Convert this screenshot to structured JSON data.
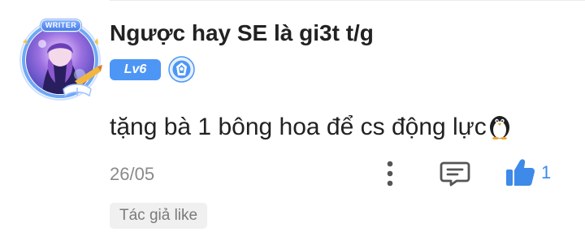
{
  "comment": {
    "username": "Ngược hay SE là gi3t t/g",
    "avatar_badge": "WRITER",
    "level": "Lv6",
    "rank_icon": "shield-badge-icon",
    "text": "tặng bà 1 bông hoa để cs động lực",
    "text_emoji": "penguin-icon",
    "date": "26/05",
    "like_count": "1",
    "author_liked_label": "Tác giả like"
  },
  "colors": {
    "accent": "#4d96f5",
    "like": "#3e8ae8",
    "text": "#222222",
    "muted": "#8a8a8a"
  },
  "icons": {
    "more": "more-vertical-icon",
    "reply": "comment-icon",
    "like": "thumbs-up-icon"
  }
}
